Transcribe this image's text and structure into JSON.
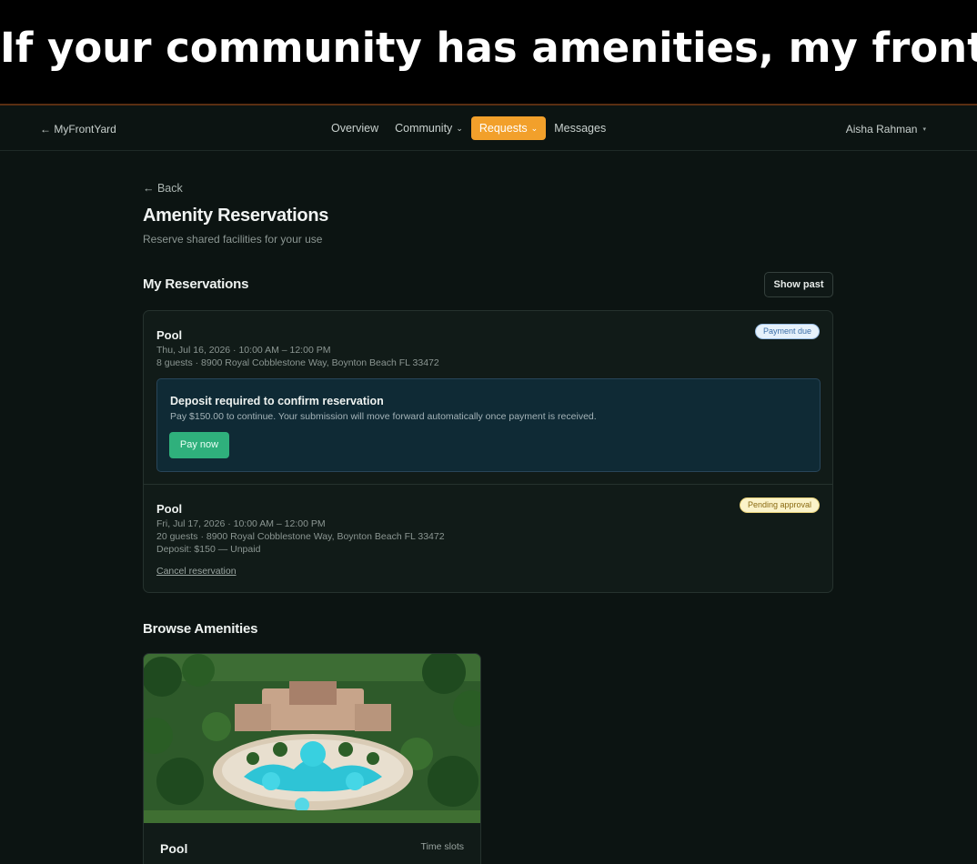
{
  "caption": "If your community has amenities, my front",
  "nav": {
    "brand": "← MyFrontYard",
    "links": [
      {
        "label": "Overview",
        "dropdown": false
      },
      {
        "label": "Community",
        "dropdown": true
      },
      {
        "label": "Requests",
        "dropdown": true,
        "active": true
      },
      {
        "label": "Messages",
        "dropdown": false
      }
    ],
    "user_name": "Aisha Rahman",
    "user_caret": "▾",
    "dropdown_chevron": "⌄"
  },
  "page": {
    "back": "← Back",
    "title": "Amenity Reservations",
    "subtitle": "Reserve shared facilities for your use"
  },
  "reservations": {
    "heading": "My Reservations",
    "show_past": "Show past",
    "items": [
      {
        "name": "Pool",
        "datetime": "Thu, Jul 16, 2026 · 10:00 AM – 12:00 PM",
        "details": "8 guests · 8900 Royal Cobblestone Way, Boynton Beach FL 33472",
        "badge": "Payment due",
        "deposit_title": "Deposit required to confirm reservation",
        "deposit_text": "Pay $150.00 to continue. Your submission will move forward automatically once payment is received.",
        "pay_button": "Pay now"
      },
      {
        "name": "Pool",
        "datetime": "Fri, Jul 17, 2026 · 10:00 AM – 12:00 PM",
        "details": "20 guests · 8900 Royal Cobblestone Way, Boynton Beach FL 33472",
        "deposit_status": "Deposit: $150 — Unpaid",
        "badge": "Pending approval",
        "cancel_link": "Cancel reservation"
      }
    ]
  },
  "amenities": {
    "heading": "Browse Amenities",
    "items": [
      {
        "name": "Pool",
        "meta": "Time slots"
      }
    ]
  },
  "colors": {
    "background": "#0c1412",
    "accent": "#f2a02b",
    "pay_button": "#2fb07c",
    "payment_due_badge": "#e6f1fb",
    "pending_badge": "#fbf3c9"
  }
}
